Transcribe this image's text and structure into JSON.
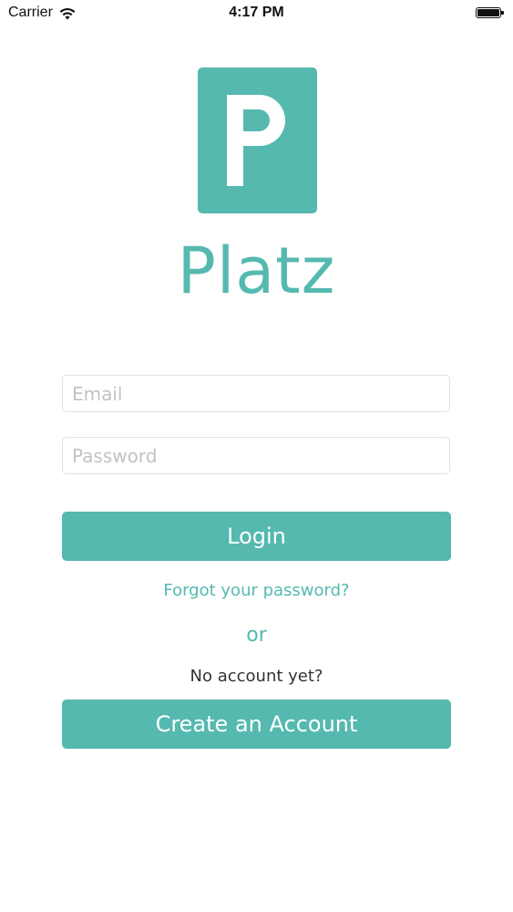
{
  "status_bar": {
    "carrier": "Carrier",
    "time": "4:17 PM",
    "wifi_icon": "wifi-icon",
    "battery_icon": "battery-icon",
    "battery_level": 1.0
  },
  "logo": {
    "letter": "P",
    "brand_name": "Platz",
    "color": "#55b9b0"
  },
  "form": {
    "email_placeholder": "Email",
    "email_value": "",
    "password_placeholder": "Password",
    "password_value": "",
    "login_label": "Login",
    "forgot_label": "Forgot your password?",
    "or_label": "or",
    "no_account_label": "No account yet?",
    "create_account_label": "Create an Account"
  }
}
